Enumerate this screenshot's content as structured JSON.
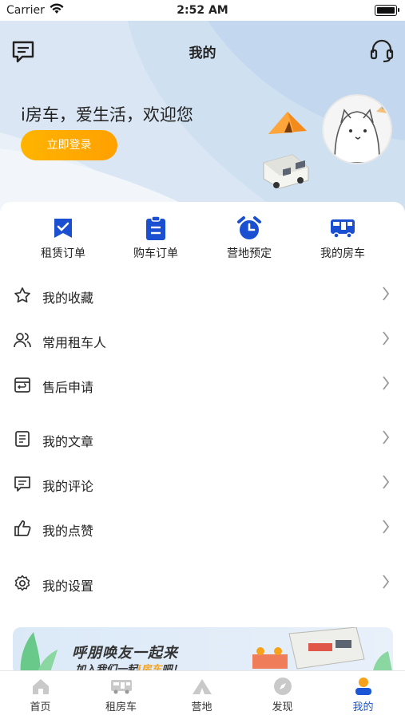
{
  "status_bar": {
    "carrier": "Carrier",
    "time": "2:52 AM"
  },
  "header": {
    "title": "我的"
  },
  "hero": {
    "welcome_text": "i房车，爱生活，欢迎您",
    "login_label": "立即登录"
  },
  "quick_actions": [
    {
      "label": "租赁订单",
      "icon": "rental-order-icon"
    },
    {
      "label": "购车订单",
      "icon": "purchase-order-icon"
    },
    {
      "label": "营地预定",
      "icon": "alarm-clock-icon"
    },
    {
      "label": "我的房车",
      "icon": "rv-icon"
    }
  ],
  "menu": [
    {
      "label": "我的收藏",
      "icon": "star-icon"
    },
    {
      "label": "常用租车人",
      "icon": "users-icon"
    },
    {
      "label": "售后申请",
      "icon": "return-box-icon"
    },
    {
      "label": "我的文章",
      "icon": "document-icon"
    },
    {
      "label": "我的评论",
      "icon": "comment-icon"
    },
    {
      "label": "我的点赞",
      "icon": "thumbs-up-icon"
    },
    {
      "label": "我的设置",
      "icon": "gear-icon"
    }
  ],
  "banner": {
    "line1": "呼朋唤友一起来",
    "line2_prefix": "加入我们一起",
    "line2_highlight": "i房车",
    "line2_suffix": "吧！"
  },
  "tabs": [
    {
      "label": "首页",
      "icon": "home-icon"
    },
    {
      "label": "租房车",
      "icon": "rv-icon"
    },
    {
      "label": "营地",
      "icon": "camp-icon"
    },
    {
      "label": "发现",
      "icon": "compass-icon"
    },
    {
      "label": "我的",
      "icon": "profile-icon",
      "active": true
    }
  ],
  "colors": {
    "accent": "#1a56d6",
    "login_button": "#ffae00",
    "hero_bg": "#e7eef7"
  }
}
